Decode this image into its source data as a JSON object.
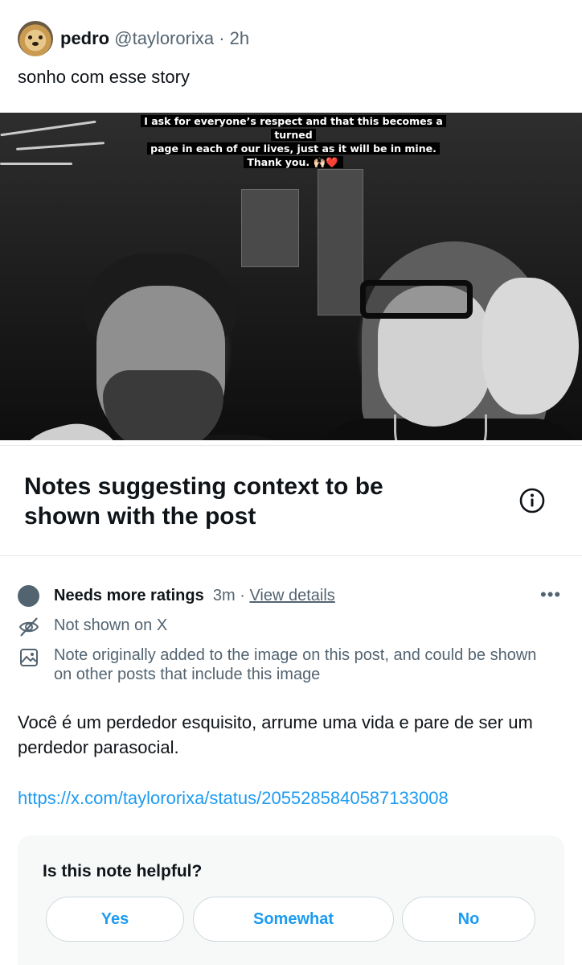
{
  "post": {
    "display_name": "pedro",
    "handle": "@taylororixa",
    "separator": "·",
    "time": "2h",
    "text": "sonho com esse story"
  },
  "image": {
    "caption_line1": "I ask for everyone’s respect and that this becomes a turned",
    "caption_line2": "page in each of our lives, just as it will be in mine.",
    "caption_line3": "Thank you. 🙌🏻",
    "caption_hearts": "❤️"
  },
  "notes": {
    "title": "Notes suggesting context to be shown with the post",
    "info_icon": "info-icon"
  },
  "note": {
    "status": "Needs more ratings",
    "age": "3m",
    "separator": "·",
    "view_details": "View details",
    "more_icon": "more-icon",
    "not_shown": "Not shown on X",
    "origin": "Note originally added to the image on this post, and could be shown on other posts that include this image",
    "body": "Você é um perdedor esquisito, arrume uma vida e pare de ser um perdedor parasocial.",
    "link": "https://x.com/taylororixa/status/2055285840587133008"
  },
  "helpful": {
    "question": "Is this note helpful?",
    "yes": "Yes",
    "somewhat": "Somewhat",
    "no": "No"
  },
  "colors": {
    "accent": "#1d9bf0",
    "secondary_text": "#536471",
    "primary_text": "#0f1419",
    "card_bg": "#f7f9f9"
  }
}
